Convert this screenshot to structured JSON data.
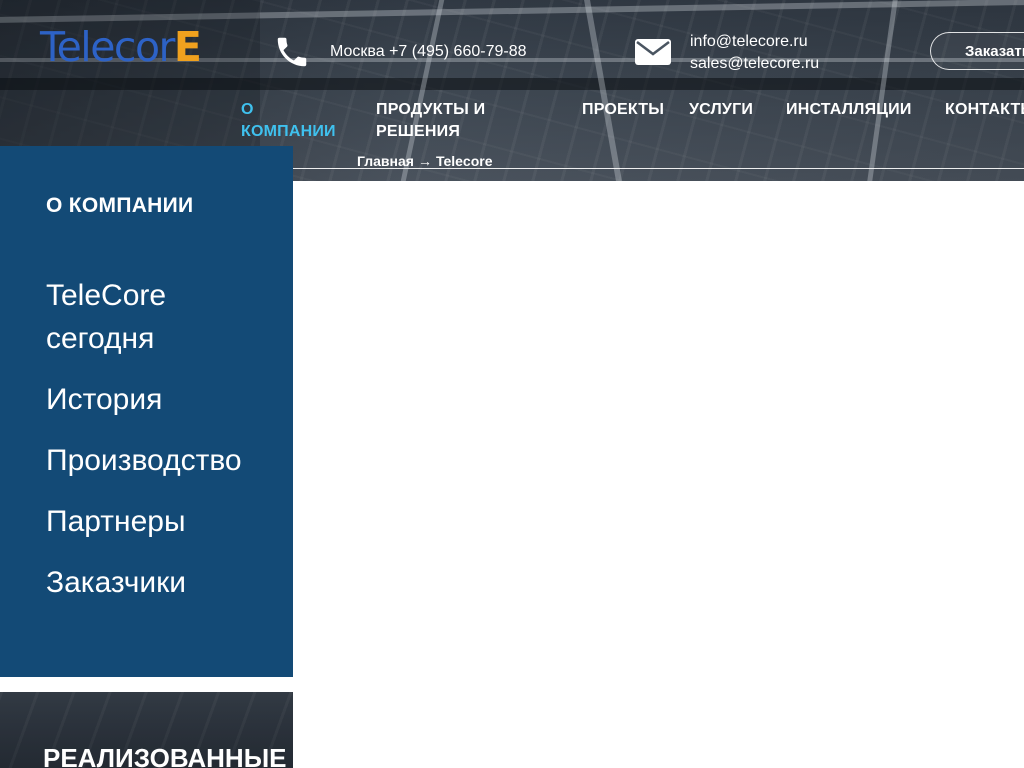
{
  "header": {
    "logo_main": "Telecor",
    "logo_accent": "E",
    "phone_text": "Москва +7 (495) 660-79-88",
    "emails": [
      "info@telecore.ru",
      "sales@telecore.ru"
    ],
    "order_button": "Заказать"
  },
  "nav": {
    "items": [
      {
        "lines": [
          "О",
          "КОМПАНИИ"
        ],
        "active": true
      },
      {
        "lines": [
          "ПРОДУКТЫ И",
          "РЕШЕНИЯ"
        ],
        "active": false
      },
      {
        "lines": [
          "ПРОЕКТЫ"
        ],
        "active": false
      },
      {
        "lines": [
          "УСЛУГИ"
        ],
        "active": false
      },
      {
        "lines": [
          "ИНСТАЛЛЯЦИИ"
        ],
        "active": false
      },
      {
        "lines": [
          "КОНТАКТЫ"
        ],
        "active": false
      }
    ]
  },
  "breadcrumb": {
    "home": "Главная",
    "separator": "→",
    "current": "Telecore"
  },
  "sidebar": {
    "title": "О КОМПАНИИ",
    "links": [
      "TeleCore",
      "сегодня",
      "История",
      "Производство",
      "Партнеры",
      "Заказчики"
    ]
  },
  "promo": {
    "title": "РЕАЛИЗОВАННЫЕ"
  },
  "colors": {
    "sidebar_bg": "#134a76",
    "nav_active": "#3fc1ee",
    "logo_blue": "#2d62c6",
    "logo_orange": "#f0a11e"
  },
  "icons": {
    "phone": "phone-icon",
    "mail": "mail-icon"
  }
}
